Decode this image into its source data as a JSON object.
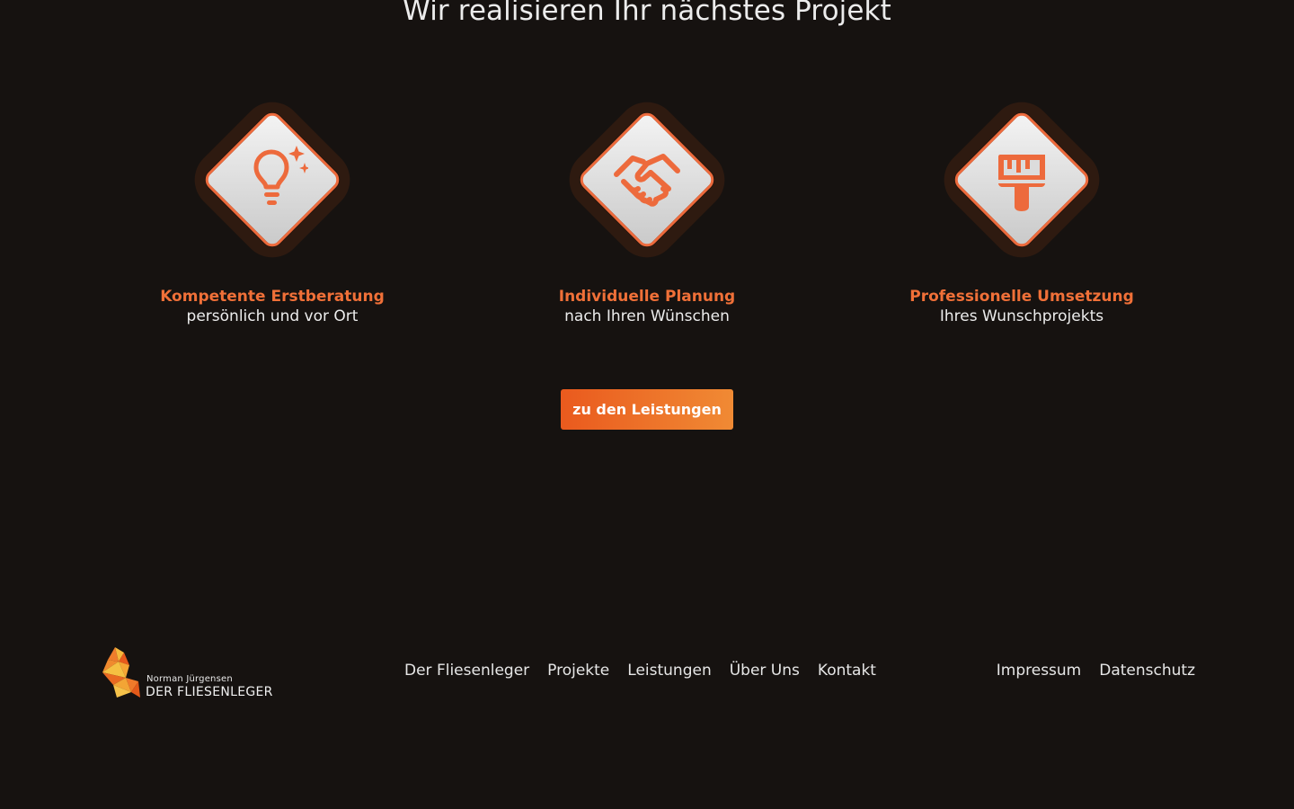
{
  "section": {
    "title": "Wir realisieren Ihr nächstes Projekt"
  },
  "features": [
    {
      "icon": "lightbulb-icon",
      "title": "Kompetente Erstberatung",
      "subtitle": "persönlich und vor Ort"
    },
    {
      "icon": "handshake-icon",
      "title": "Individuelle Planung",
      "subtitle": "nach Ihren Wünschen"
    },
    {
      "icon": "paint-brush-icon",
      "title": "Professionelle Umsetzung",
      "subtitle": "Ihres Wunschprojekts"
    }
  ],
  "cta": {
    "label": "zu den Leistungen"
  },
  "footer": {
    "logo": {
      "owner": "Norman Jürgensen",
      "company": "DER FLIESENLEGER"
    },
    "nav": [
      "Der Fliesenleger",
      "Projekte",
      "Leistungen",
      "Über Uns",
      "Kontakt"
    ],
    "legal": [
      "Impressum",
      "Datenschutz"
    ]
  },
  "colors": {
    "background": "#161210",
    "accent": "#f07038",
    "button_gradient_start": "#ea5a1e",
    "button_gradient_end": "#f08a34",
    "text": "#ececec"
  }
}
